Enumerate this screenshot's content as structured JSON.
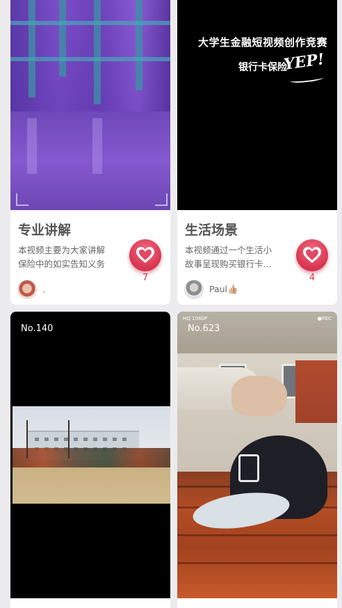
{
  "cards": [
    {
      "title": "专业讲解",
      "desc_lines": [
        "本视频主要为大家讲解",
        "保险中的如实告知义务"
      ],
      "author": ".",
      "likes": "7"
    },
    {
      "overlay_line1": "大学生金融短视频创作竞赛",
      "overlay_line2": "银行卡保险",
      "overlay_logo": "YEP!",
      "title": "生活场景",
      "desc_lines": [
        "本视频通过一个生活小",
        "故事呈现购买银行卡..."
      ],
      "author": "Paul👍🏼",
      "likes": "4"
    },
    {
      "number": "No.140"
    },
    {
      "number": "No.623",
      "rec_left": "HQ 1080P",
      "rec_right": "●REC"
    }
  ],
  "colors": {
    "background": "#ececee",
    "like_red": "#d8334f"
  }
}
